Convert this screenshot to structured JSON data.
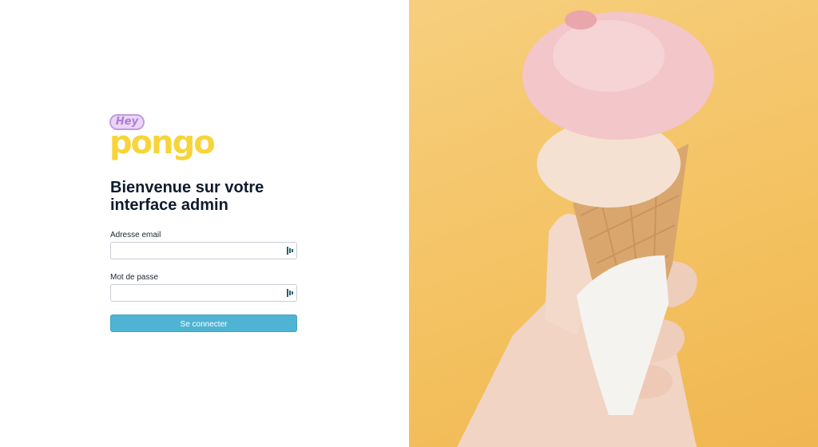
{
  "brand": {
    "hey": "Hey",
    "name": "pongo",
    "accent_yellow": "#f7d43a",
    "accent_purple": "#c49be0"
  },
  "login": {
    "title": "Bienvenue sur votre interface admin",
    "email_label": "Adresse email",
    "email_value": "",
    "password_label": "Mot de passe",
    "password_value": "",
    "submit_label": "Se connecter",
    "button_color": "#4fb3d4"
  },
  "hero": {
    "image": "ice-cream-cone-in-hand",
    "background": "#f4c262"
  }
}
